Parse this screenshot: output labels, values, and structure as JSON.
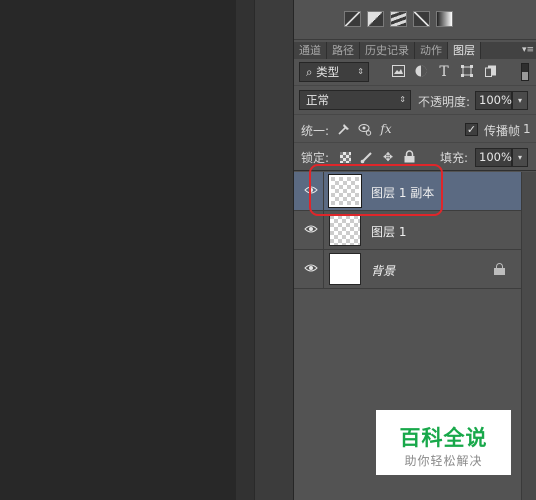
{
  "tabs": [
    {
      "label": "通道",
      "active": false
    },
    {
      "label": "路径",
      "active": false
    },
    {
      "label": "历史记录",
      "active": false
    },
    {
      "label": "动作",
      "active": false
    },
    {
      "label": "图层",
      "active": true
    }
  ],
  "tab_menu": "▾≡",
  "filter": {
    "icon": "⌕",
    "label": "类型",
    "arrow": "⇕"
  },
  "filter_icons": [
    "image-filter-icon",
    "adjustment-filter-icon",
    "type-filter-icon",
    "shape-filter-icon",
    "smart-object-filter-icon"
  ],
  "blend": {
    "mode": "正常",
    "opacity_label": "不透明度:",
    "opacity_value": "100%"
  },
  "unify": {
    "label": "统一:",
    "propagate_label": "传播帧",
    "propagate_value": "1",
    "propagate_checked": true
  },
  "lock": {
    "label": "锁定:",
    "fill_label": "填充:",
    "fill_value": "100%"
  },
  "layers": [
    {
      "name": "图层 1 副本",
      "selected": true,
      "thumb": "transparent",
      "locked": false,
      "italic": false
    },
    {
      "name": "图层 1",
      "selected": false,
      "thumb": "transparent",
      "locked": false,
      "italic": false
    },
    {
      "name": "背景",
      "selected": false,
      "thumb": "white",
      "locked": true,
      "italic": true
    }
  ],
  "watermark": {
    "title": "百科全说",
    "subtitle": "助你轻松解决"
  },
  "colors": {
    "selection": "#5b6a82",
    "highlight": "#e0262a",
    "brand_green": "#18a84a"
  }
}
